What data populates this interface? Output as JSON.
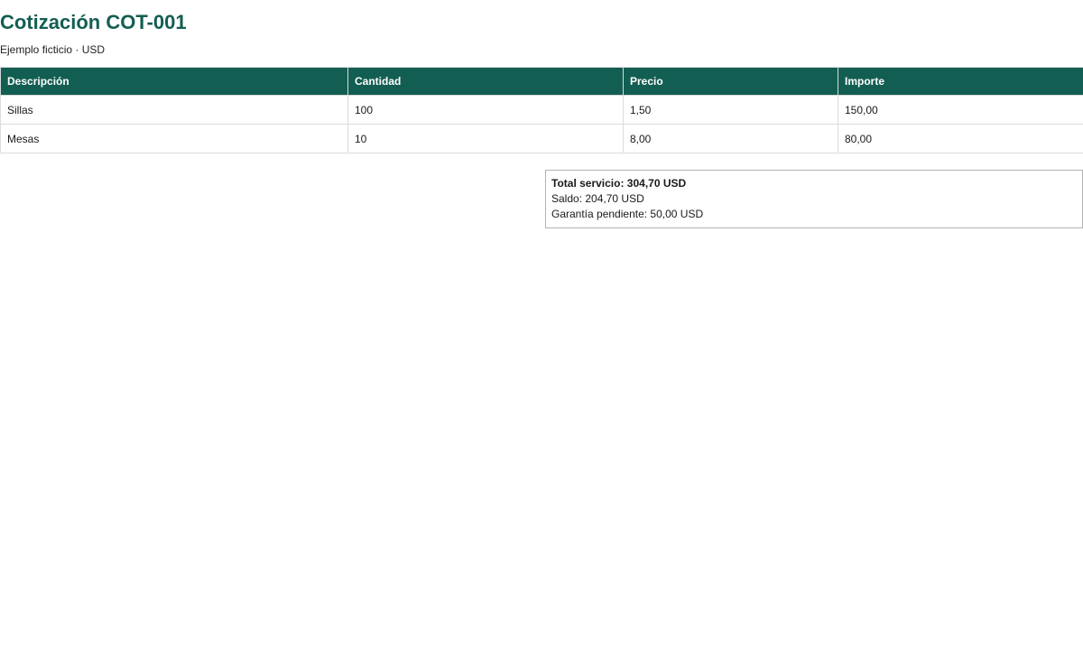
{
  "document": {
    "title": "Cotización COT-001",
    "subtitle": "Ejemplo ficticio · USD"
  },
  "table": {
    "columns": [
      "Descripción",
      "Cantidad",
      "Precio",
      "Importe"
    ],
    "rows": [
      {
        "descripcion": "Sillas",
        "cantidad": "100",
        "precio": "1,50",
        "importe": "150,00"
      },
      {
        "descripcion": "Mesas",
        "cantidad": "10",
        "precio": "8,00",
        "importe": "80,00"
      }
    ]
  },
  "totals": {
    "total_servicio": "Total servicio: 304,70 USD",
    "saldo": "Saldo: 204,70 USD",
    "garantia_pendiente": "Garantía pendiente: 50,00 USD"
  },
  "colors": {
    "accent": "#135e52",
    "header_text": "#ffffff",
    "border": "#dcdcdc"
  }
}
